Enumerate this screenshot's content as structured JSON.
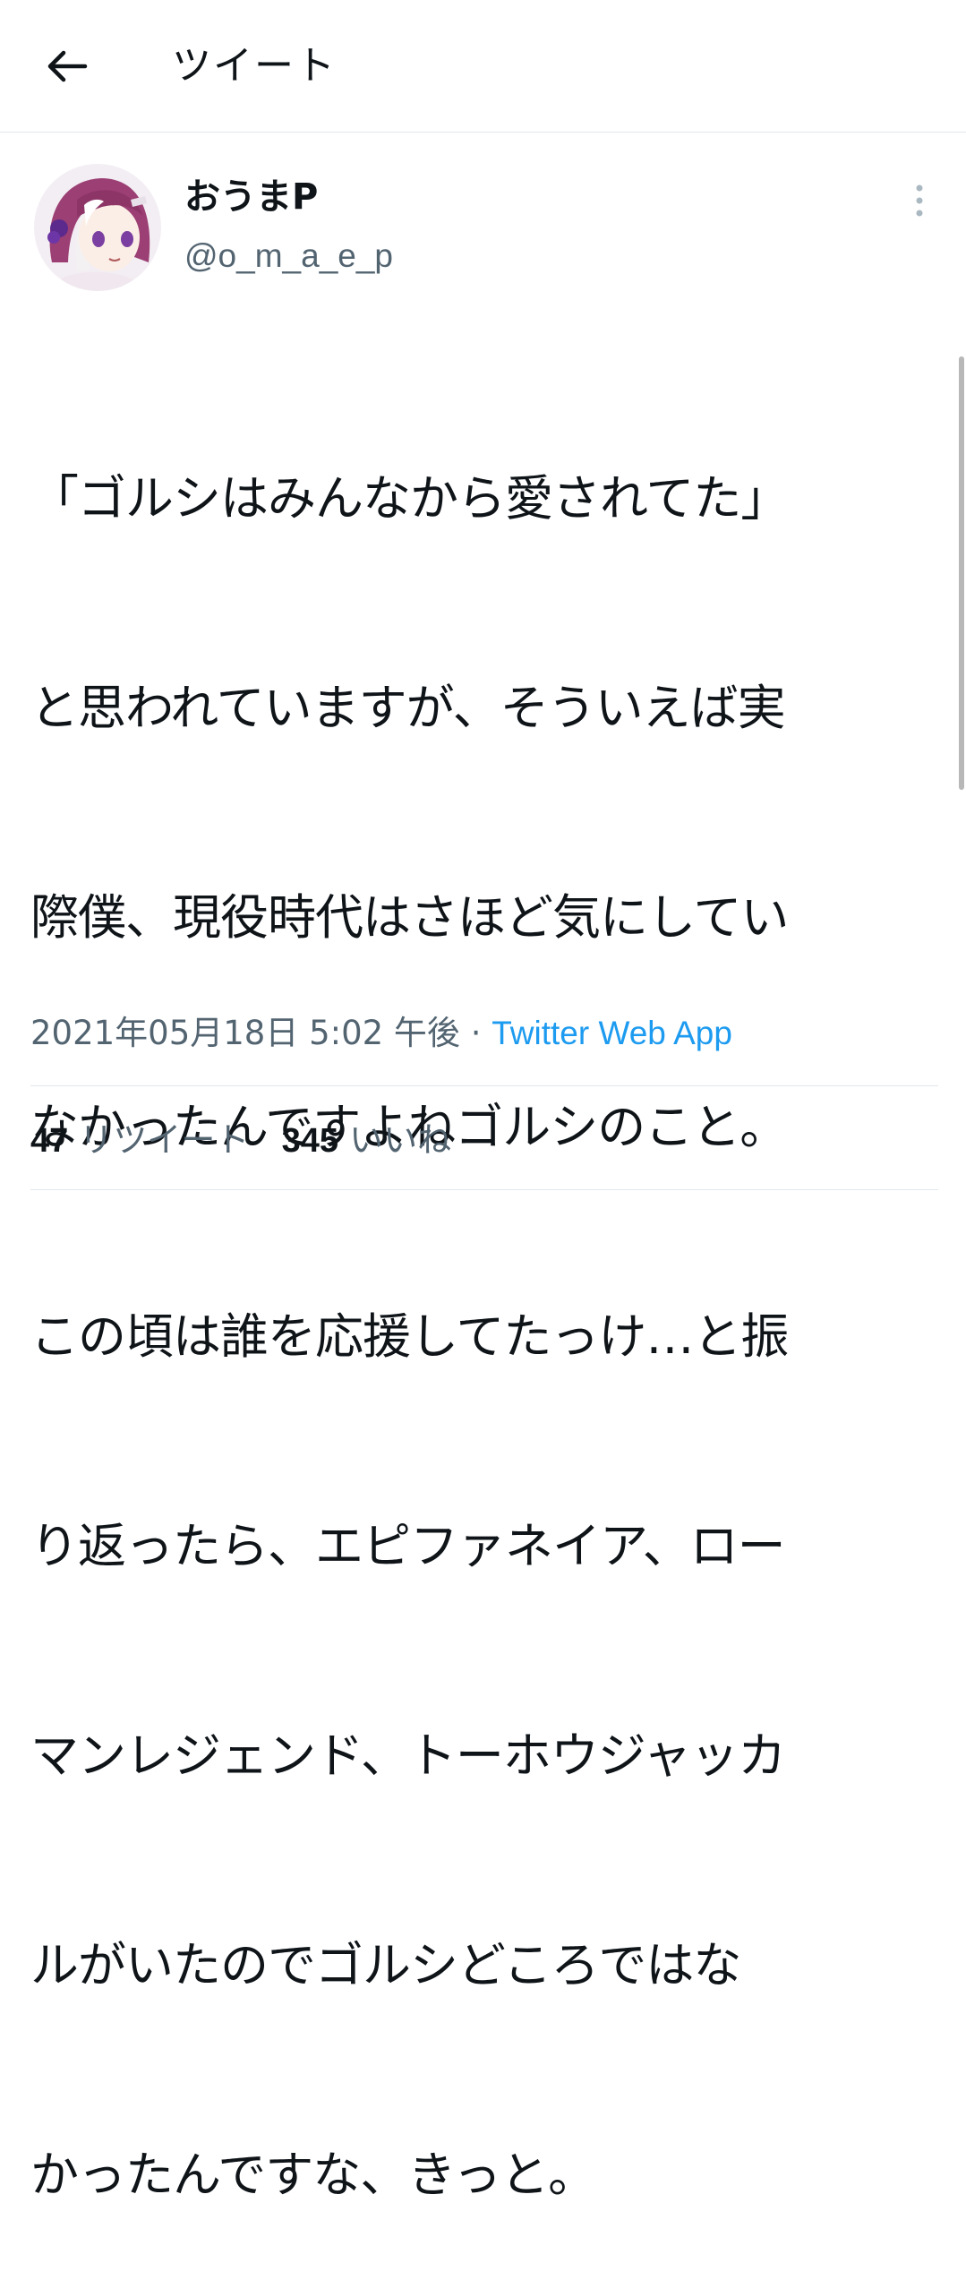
{
  "header": {
    "back_icon": "arrow-left-icon",
    "title": "ツイート"
  },
  "author": {
    "display_name": "おうまP",
    "handle": "@o_m_a_e_p",
    "avatar_icon": "avatar-illustration",
    "more_icon": "vertical-dots-icon"
  },
  "tweet": {
    "lines": [
      "「ゴルシはみんなから愛されてた」",
      "と思われていますが、そういえば実",
      "際僕、現役時代はさほど気にしてい",
      "なかったんですよねゴルシのこと。",
      "この頃は誰を応援してたっけ…と振",
      "り返ったら、エピファネイア、ロー",
      "マンレジェンド、トーホウジャッカ",
      "ルがいたのでゴルシどころではな",
      "かったんですな、きっと。"
    ],
    "timestamp": "2021年05月18日 5:02 午後",
    "separator": " · ",
    "source": "Twitter Web App"
  },
  "stats": {
    "retweets_count": "47",
    "retweets_label": "リツイート",
    "likes_count": "345",
    "likes_label": "いいね"
  },
  "colors": {
    "text": "#0f1419",
    "secondary": "#536471",
    "link": "#1d9bf0",
    "divider": "#e1e8ed"
  }
}
